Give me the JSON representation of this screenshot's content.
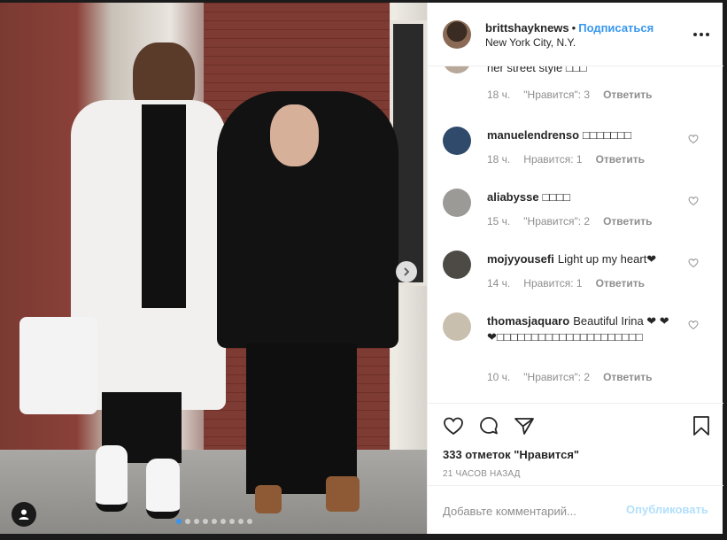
{
  "post": {
    "username": "brittshayknews",
    "separator": "•",
    "follow_label": "Подписаться",
    "location": "New York City, N.Y."
  },
  "comments": [
    {
      "username": "",
      "text": "her street style □□□",
      "age": "18 ч.",
      "likes": "\"Нравится\": 3",
      "reply": "Ответить",
      "avatar_color": "#b8a89a"
    },
    {
      "username": "manuelendrenso",
      "text": "□□□□□□□",
      "age": "18 ч.",
      "likes": "Нравится: 1",
      "reply": "Ответить",
      "avatar_color": "#2f4a6b"
    },
    {
      "username": "aliabysse",
      "text": "□□□□",
      "age": "15 ч.",
      "likes": "\"Нравится\": 2",
      "reply": "Ответить",
      "avatar_color": "#9c9a96"
    },
    {
      "username": "mojyyousefi",
      "text": "Light up my heart❤",
      "age": "14 ч.",
      "likes": "Нравится: 1",
      "reply": "Ответить",
      "avatar_color": "#4d4a46"
    },
    {
      "username": "thomasjaquaro",
      "text": "Beautiful Irina ❤ ❤❤□□□□□□□□□□□□□□□□□□□□□",
      "age": "10 ч.",
      "likes": "\"Нравится\": 2",
      "reply": "Ответить",
      "avatar_color": "#c8bfae"
    }
  ],
  "likes_text": "333 отметок \"Нравится\"",
  "time_text": "21 ЧАСОВ НАЗАД",
  "comment_input": {
    "placeholder": "Добавьте комментарий...",
    "value": ""
  },
  "publish_label": "Опубликовать",
  "colors": {
    "accent": "#3897f0",
    "publish_disabled": "#b2dffc",
    "meta": "#8e8e8e"
  },
  "icons": {
    "like": "heart-icon",
    "comment": "comment-icon",
    "share": "share-icon",
    "save": "bookmark-icon",
    "next": "chevron-right-icon",
    "tag": "user-tag-icon",
    "more": "more-options-icon"
  },
  "carousel": {
    "total": 9,
    "active": 1
  }
}
